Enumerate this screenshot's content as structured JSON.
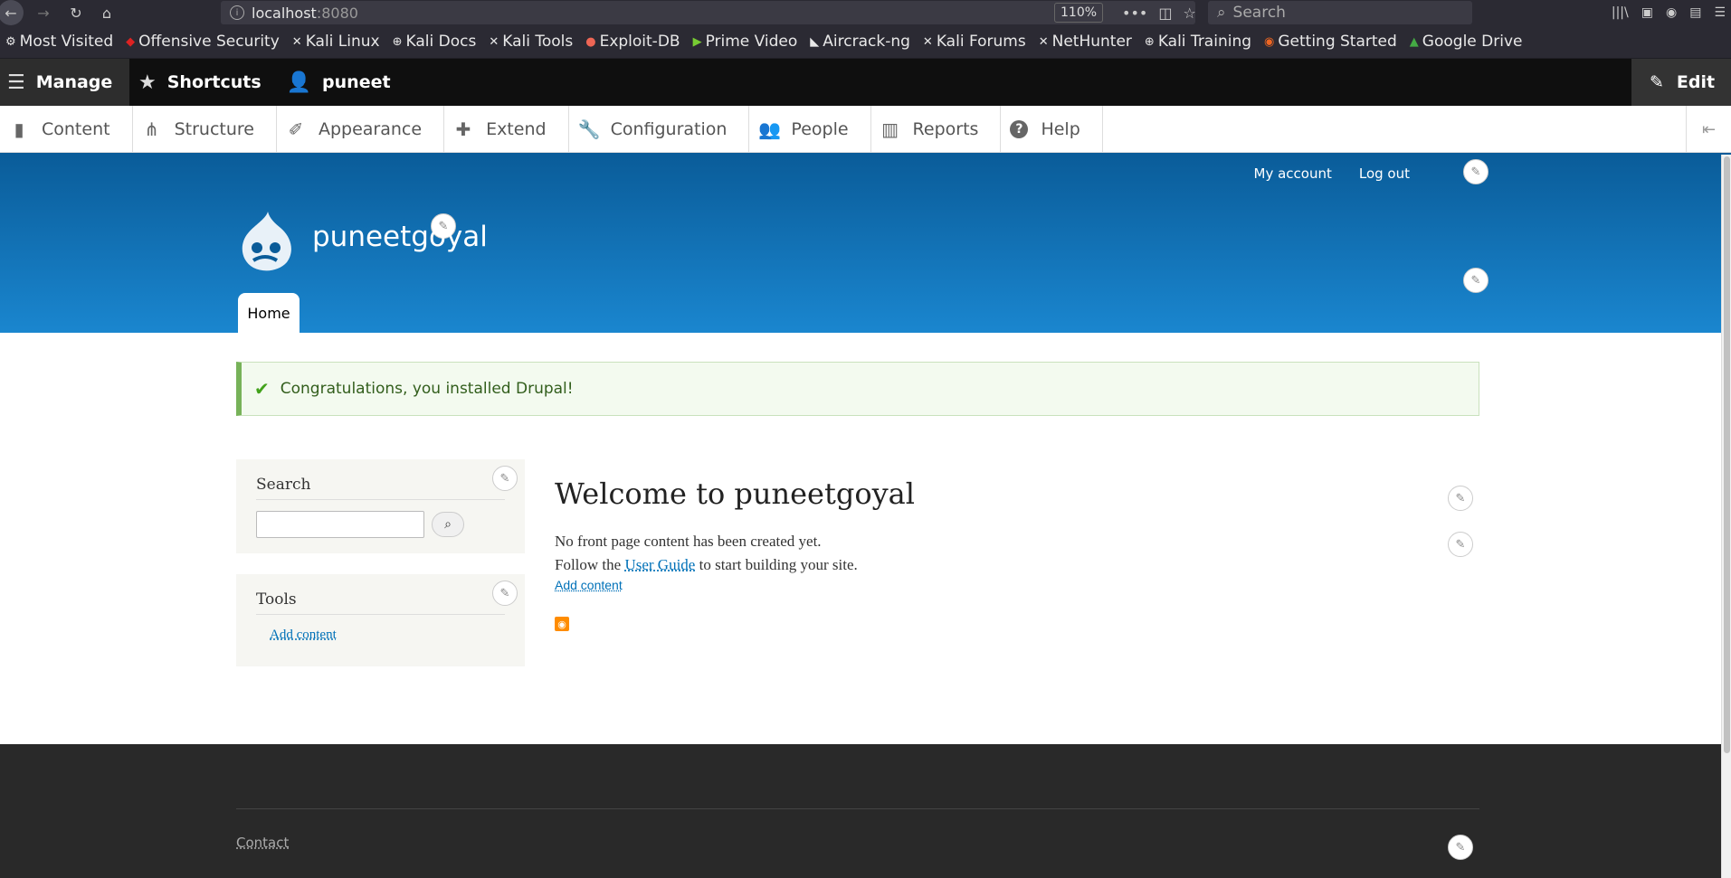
{
  "browser": {
    "url_host": "localhost",
    "url_port": ":8080",
    "zoom": "110%",
    "search_placeholder": "Search",
    "bookmarks": [
      {
        "label": "Most Visited",
        "icon": "gear-icon"
      },
      {
        "label": "Offensive Security",
        "icon": "offsec-icon"
      },
      {
        "label": "Kali Linux",
        "icon": "kali-icon"
      },
      {
        "label": "Kali Docs",
        "icon": "globe-icon"
      },
      {
        "label": "Kali Tools",
        "icon": "kali-icon"
      },
      {
        "label": "Exploit-DB",
        "icon": "exploitdb-icon"
      },
      {
        "label": "Prime Video",
        "icon": "play-icon"
      },
      {
        "label": "Aircrack-ng",
        "icon": "aircrack-icon"
      },
      {
        "label": "Kali Forums",
        "icon": "kali-icon"
      },
      {
        "label": "NetHunter",
        "icon": "kali-icon"
      },
      {
        "label": "Kali Training",
        "icon": "globe-icon"
      },
      {
        "label": "Getting Started",
        "icon": "firefox-icon"
      },
      {
        "label": "Google Drive",
        "icon": "drive-icon"
      }
    ]
  },
  "toolbar": {
    "manage": "Manage",
    "shortcuts": "Shortcuts",
    "user": "puneet",
    "edit": "Edit"
  },
  "tray": {
    "items": [
      {
        "label": "Content",
        "icon": "file-icon"
      },
      {
        "label": "Structure",
        "icon": "sitemap-icon"
      },
      {
        "label": "Appearance",
        "icon": "brush-icon"
      },
      {
        "label": "Extend",
        "icon": "puzzle-icon"
      },
      {
        "label": "Configuration",
        "icon": "wrench-icon"
      },
      {
        "label": "People",
        "icon": "people-icon"
      },
      {
        "label": "Reports",
        "icon": "bar-chart-icon"
      },
      {
        "label": "Help",
        "icon": "help-icon"
      }
    ]
  },
  "header": {
    "my_account": "My account",
    "log_out": "Log out",
    "site_name": "puneetgoyal",
    "home_tab": "Home"
  },
  "message": {
    "text": "Congratulations, you installed Drupal!"
  },
  "sidebar": {
    "search_title": "Search",
    "tools_title": "Tools",
    "tools_link": "Add content"
  },
  "main": {
    "title": "Welcome to puneetgoyal",
    "line1": "No front page content has been created yet.",
    "line2_pre": "Follow the ",
    "line2_link": "User Guide",
    "line2_post": " to start building your site.",
    "add_content": "Add content"
  },
  "footer": {
    "contact": "Contact"
  },
  "colors": {
    "header_top": "#0a5c99",
    "header_bottom": "#1a86cf",
    "message_border": "#77b259",
    "link": "#0071b8"
  }
}
